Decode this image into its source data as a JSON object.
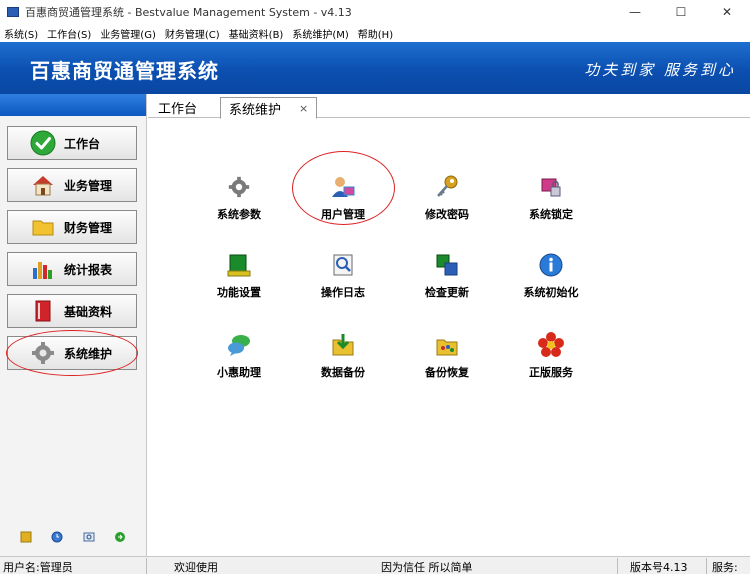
{
  "window": {
    "title": "百惠商贸通管理系统 - Bestvalue Management System - v4.13",
    "controls": [
      "—",
      "☐",
      "✕"
    ]
  },
  "menu": [
    "系统(S)",
    "工作台(S)",
    "业务管理(G)",
    "财务管理(C)",
    "基础资料(B)",
    "系统维护(M)",
    "帮助(H)"
  ],
  "banner": {
    "app_name": "百惠商贸通管理系统",
    "slogan": "功夫到家 服务到心"
  },
  "sidebar": {
    "items": [
      {
        "label": "工作台",
        "icon": "check-icon"
      },
      {
        "label": "业务管理",
        "icon": "house-icon"
      },
      {
        "label": "财务管理",
        "icon": "folder-icon"
      },
      {
        "label": "统计报表",
        "icon": "bar-chart-icon"
      },
      {
        "label": "基础资料",
        "icon": "book-icon"
      },
      {
        "label": "系统维护",
        "icon": "gear-icon"
      }
    ],
    "selected": "系统维护",
    "tools": [
      "key-icon",
      "clock-icon",
      "search-icon",
      "exit-icon"
    ]
  },
  "tabs": [
    {
      "label": "工作台"
    },
    {
      "label": "系统维护",
      "close": "×"
    }
  ],
  "tiles": [
    {
      "label": "系统参数",
      "icon": "gear-icon"
    },
    {
      "label": "用户管理",
      "icon": "user-manage-icon"
    },
    {
      "label": "修改密码",
      "icon": "key-icon"
    },
    {
      "label": "系统锁定",
      "icon": "lock-icon"
    },
    {
      "label": "功能设置",
      "icon": "function-settings-icon"
    },
    {
      "label": "操作日志",
      "icon": "log-icon"
    },
    {
      "label": "检查更新",
      "icon": "update-icon"
    },
    {
      "label": "系统初始化",
      "icon": "info-icon"
    },
    {
      "label": "小惠助理",
      "icon": "chat-icon"
    },
    {
      "label": "数据备份",
      "icon": "backup-icon"
    },
    {
      "label": "备份恢复",
      "icon": "restore-icon"
    },
    {
      "label": "正版服务",
      "icon": "flower-icon"
    }
  ],
  "status": {
    "user": "用户名:管理员",
    "welcome": "欢迎使用",
    "motto": "因为信任 所以简单",
    "version": "版本号4.13",
    "service": "服务:"
  },
  "colors": {
    "banner": "#0b4fb0",
    "highlight_ring": "#dd2222"
  }
}
